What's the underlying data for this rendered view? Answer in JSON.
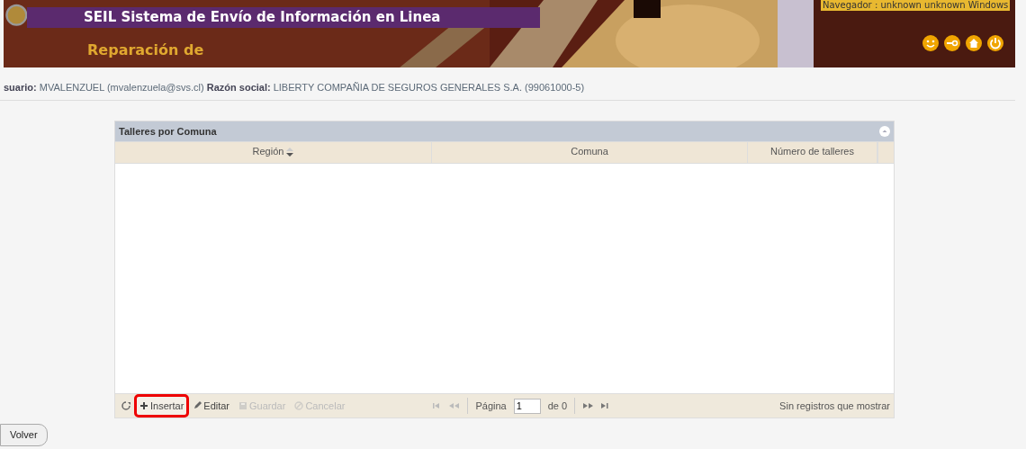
{
  "header": {
    "title": "SEIL Sistema de Envío de Información en Linea",
    "subtitle": "Reparación de",
    "browser_info": "Navegador : unknown unknown Windows",
    "icons": [
      {
        "kind": "support"
      },
      {
        "kind": "key"
      },
      {
        "kind": "home"
      },
      {
        "kind": "power"
      }
    ]
  },
  "user_line": "**suario:** MVALENZUEL (mvalenzuela@svs.cl) **Razón social:** LIBERTY COMPAÑIA DE SEGUROS GENERALES S.A. (99061000-5)",
  "grid": {
    "caption": "Talleres por Comuna",
    "columns": [
      {
        "label": "Región",
        "sortable": true
      },
      {
        "label": "Comuna",
        "sortable": false
      },
      {
        "label": "Número de talleres",
        "sortable": false
      }
    ],
    "toolbar": [
      {
        "kind": "refresh",
        "disabled": false,
        "highlighted": false
      },
      {
        "kind": "add",
        "label": "Insertar",
        "disabled": false,
        "highlighted": true
      },
      {
        "kind": "edit",
        "label": "Editar",
        "disabled": false,
        "highlighted": false
      },
      {
        "kind": "save",
        "label": "Guardar",
        "disabled": true,
        "highlighted": false
      },
      {
        "kind": "cancel",
        "label": "Cancelar",
        "disabled": true,
        "highlighted": false
      }
    ],
    "pager": {
      "page_label": "Página",
      "page_value": "1",
      "of_label": "de 0",
      "status": "Sin registros que mostrar"
    }
  },
  "back_button": "Volver"
}
